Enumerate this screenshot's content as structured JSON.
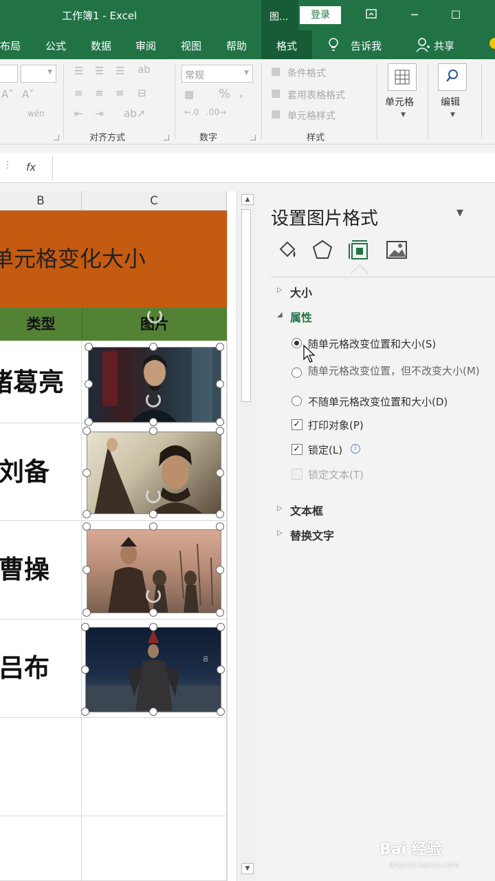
{
  "app": {
    "title": "工作簿1  -  Excel",
    "context_label": "图...",
    "login": "登录"
  },
  "window": {
    "restore_icon": "ribbon-display-icon",
    "minimize": "─",
    "maximize": "☐"
  },
  "tabs": [
    {
      "label": "布局"
    },
    {
      "label": "公式"
    },
    {
      "label": "数据"
    },
    {
      "label": "审阅"
    },
    {
      "label": "视图"
    },
    {
      "label": "帮助"
    },
    {
      "label": "格式"
    }
  ],
  "tell_me": "告诉我",
  "share": "共享",
  "ribbon": {
    "number_format": "常规",
    "groups": {
      "alignment": "对齐方式",
      "number": "数字",
      "styles": "样式"
    },
    "styles_items": [
      "条件格式",
      "套用表格格式",
      "单元格样式"
    ],
    "cells_label": "单元格",
    "edit_label": "编辑",
    "percent": "%",
    "comma": ","
  },
  "formula_bar": {
    "fx": "fx",
    "value": ""
  },
  "sheet": {
    "columns": [
      "B",
      "C"
    ],
    "title_cell": "单元格变化大小",
    "header_type": "类型",
    "header_picture": "图片",
    "rows": [
      {
        "name": "诸葛亮"
      },
      {
        "name": "刘备"
      },
      {
        "name": "曹操"
      },
      {
        "name": "吕布"
      }
    ]
  },
  "pane": {
    "title": "设置图片格式",
    "menu_arrow": "▼",
    "icons": [
      "fill-line-icon",
      "effects-icon",
      "size-properties-icon",
      "picture-icon"
    ],
    "sections": {
      "size": "大小",
      "properties": "属性",
      "textbox": "文本框",
      "alt_text": "替换文字"
    },
    "options": {
      "move_and_size": "随单元格改变位置和大小(S)",
      "move_no_size": "随单元格改变位置，但不改变大小(M)",
      "no_move_no_size": "不随单元格改变位置和大小(D)",
      "print_object": "打印对象(P)",
      "locked": "锁定(L)",
      "lock_text": "锁定文本(T)"
    },
    "check_mark": "✓",
    "info": "i"
  },
  "colors": {
    "excel_green": "#217346",
    "title_fill": "#c55a11",
    "header_fill": "#548235"
  },
  "watermark": {
    "brand": "Bai 经验",
    "url": "jingyan.baidu.com"
  }
}
